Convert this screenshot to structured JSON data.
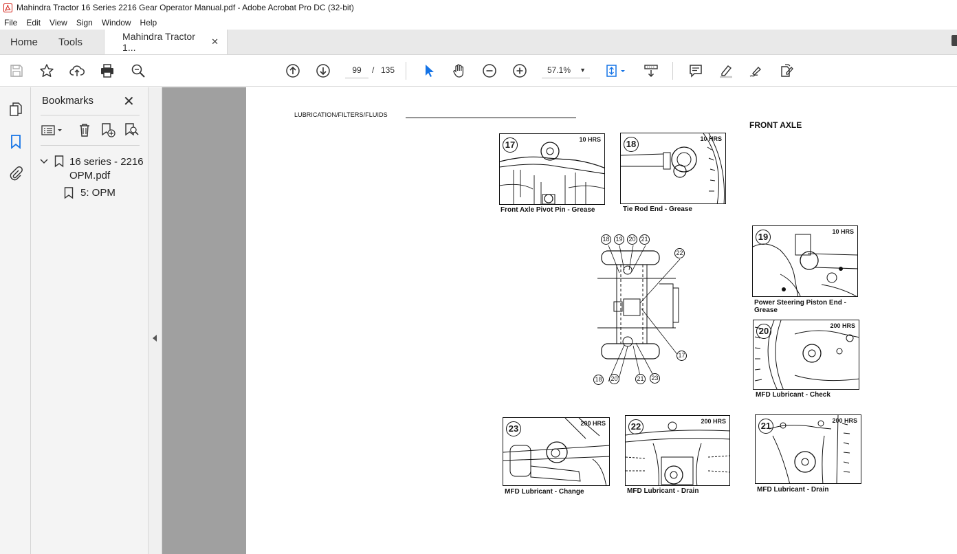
{
  "window": {
    "title": "Mahindra Tractor 16 Series 2216 Gear  Operator Manual.pdf - Adobe Acrobat Pro DC (32-bit)"
  },
  "menu": [
    "File",
    "Edit",
    "View",
    "Sign",
    "Window",
    "Help"
  ],
  "tabs": {
    "home": "Home",
    "tools": "Tools",
    "document": "Mahindra Tractor 1...",
    "close": "✕"
  },
  "toolbar": {
    "page_current": "99",
    "page_sep": "/",
    "page_total": "135",
    "zoom": "57.1%"
  },
  "bookmarks": {
    "title": "Bookmarks",
    "close": "✕",
    "items": [
      {
        "label": "16 series - 2216 OPM.pdf",
        "expanded": true
      },
      {
        "label": "5: OPM"
      }
    ]
  },
  "page": {
    "header": "LUBRICATION/FILTERS/FLUIDS",
    "section_title": "FRONT AXLE",
    "figures": [
      {
        "num": "17",
        "hrs": "10 HRS",
        "caption": "Front Axle Pivot Pin - Grease"
      },
      {
        "num": "18",
        "hrs": "10 HRS",
        "caption": "Tie Rod End - Grease"
      },
      {
        "num": "19",
        "hrs": "10 HRS",
        "caption": "Power Steering Piston End - Grease"
      },
      {
        "num": "20",
        "hrs": "200 HRS",
        "caption": "MFD Lubricant - Check"
      },
      {
        "num": "23",
        "hrs": "200 HRS",
        "caption": "MFD Lubricant - Change"
      },
      {
        "num": "22",
        "hrs": "200 HRS",
        "caption": "MFD Lubricant - Drain"
      },
      {
        "num": "21",
        "hrs": "200 HRS",
        "caption": "MFD Lubricant - Drain"
      }
    ],
    "diagram_callouts": [
      "18",
      "19",
      "20",
      "21",
      "22",
      "17",
      "18",
      "20",
      "21",
      "23"
    ]
  }
}
